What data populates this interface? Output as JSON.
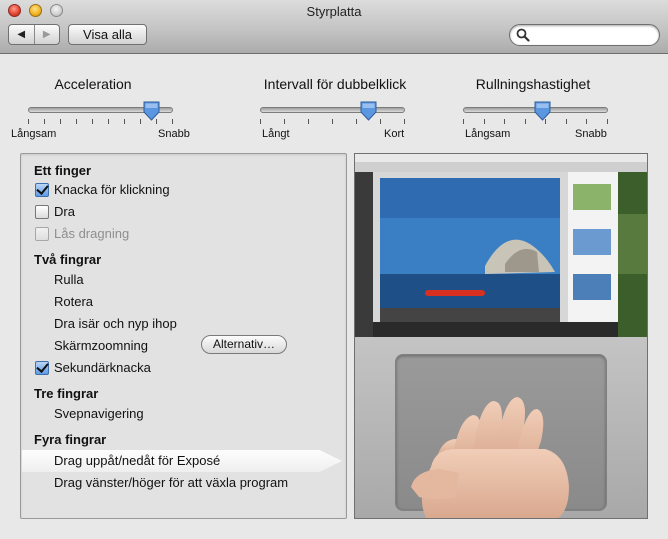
{
  "window": {
    "title": "Styrplatta"
  },
  "toolbar": {
    "back_glyph": "◀",
    "forward_glyph": "▶",
    "show_all_label": "Visa alla",
    "search": {
      "value": "",
      "placeholder": ""
    }
  },
  "sliders": [
    {
      "title": "Acceleration",
      "min_label": "Långsam",
      "max_label": "Snabb",
      "value": 0.85
    },
    {
      "title": "Intervall för dubbelklick",
      "min_label": "Långt",
      "max_label": "Kort",
      "value": 0.75
    },
    {
      "title": "Rullningshastighet",
      "min_label": "Långsam",
      "max_label": "Snabb",
      "value": 0.55
    }
  ],
  "options": {
    "one_finger": {
      "heading": "Ett finger",
      "tap_to_click": {
        "label": "Knacka för klickning",
        "checked": true
      },
      "drag": {
        "label": "Dra",
        "checked": false
      },
      "drag_lock": {
        "label": "Lås dragning",
        "checked": false,
        "enabled": false
      }
    },
    "two_fingers": {
      "heading": "Två fingrar",
      "scroll": "Rulla",
      "rotate": "Rotera",
      "pinch": "Dra isär och nyp ihop",
      "zoom": "Skärmzoomning",
      "options_button": "Alternativ…",
      "secondary_click": {
        "label": "Sekundärknacka",
        "checked": true
      }
    },
    "three_fingers": {
      "heading": "Tre fingrar",
      "swipe": "Svepnavigering"
    },
    "four_fingers": {
      "heading": "Fyra fingrar",
      "expose": "Drag uppåt/nedåt för Exposé",
      "app_switch": "Drag vänster/höger för att växla program"
    }
  },
  "colors": {
    "accent_blue": "#5e9be6",
    "window_bg": "#e8e8e8"
  }
}
